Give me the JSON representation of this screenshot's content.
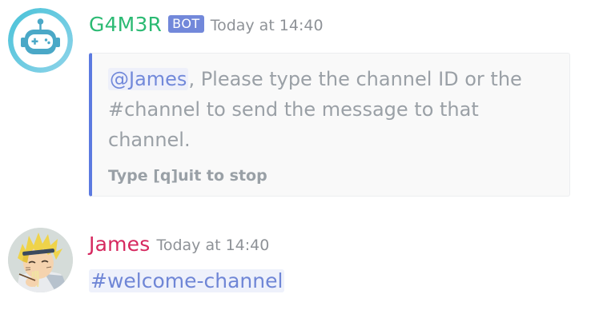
{
  "messages": [
    {
      "author": "G4M3R",
      "bot_tag": "BOT",
      "timestamp": "Today at 14:40",
      "avatar_icon": "robot-icon",
      "embed": {
        "mention": "@James",
        "description": ", Please type the channel ID or the #channel to send the message to that channel.",
        "footer": "Type [q]uit to stop",
        "accent_color": "#5c7ae0"
      }
    },
    {
      "author": "James",
      "timestamp": "Today at 14:40",
      "avatar_icon": "anime-character-avatar",
      "content": "#welcome-channel"
    }
  ],
  "colors": {
    "bot_name": "#2bba73",
    "user_name": "#d6285f",
    "bot_tag_bg": "#7288da",
    "timestamp": "#8e9297",
    "mention": "#7289da"
  }
}
